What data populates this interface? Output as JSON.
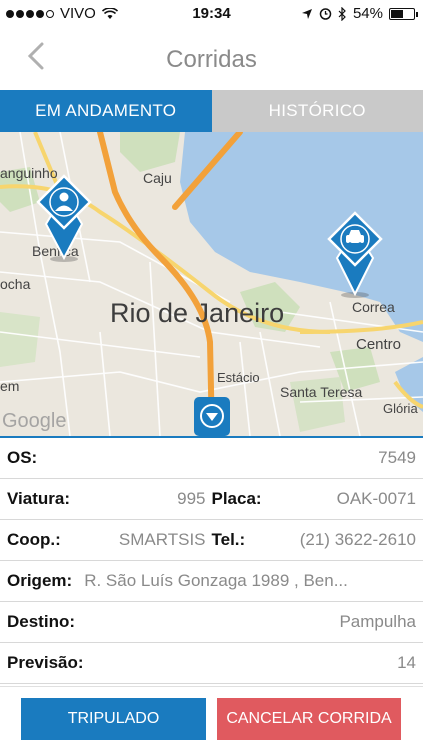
{
  "status_bar": {
    "carrier": "VIVO",
    "time": "19:34",
    "battery": "54%",
    "battery_level": 0.54
  },
  "nav": {
    "title": "Corridas"
  },
  "tabs": [
    {
      "label": "EM ANDAMENTO",
      "active": true
    },
    {
      "label": "HISTÓRICO",
      "active": false
    }
  ],
  "map": {
    "city": "Rio de Janeiro",
    "places": [
      "anguinho",
      "Caju",
      "Benfica",
      "ocha",
      "Correa",
      "Centro",
      "Estácio",
      "Santa Teresa",
      "Glória",
      "em"
    ],
    "attribution": "Google",
    "markers": [
      "person-marker-icon",
      "taxi-marker-icon",
      "location-marker-icon"
    ]
  },
  "details": {
    "os": {
      "label": "OS:",
      "value": "7549"
    },
    "viatura": {
      "label": "Viatura:",
      "value": "995"
    },
    "placa": {
      "label": "Placa:",
      "value": "OAK-0071"
    },
    "coop": {
      "label": "Coop.:",
      "value": "SMARTSIS"
    },
    "tel": {
      "label": "Tel.:",
      "value": "(21) 3622-2610"
    },
    "origem": {
      "label": "Origem:",
      "value": "R. São Luís Gonzaga 1989 , Ben..."
    },
    "destino": {
      "label": "Destino:",
      "value": "Pampulha"
    },
    "previsao": {
      "label": "Previsão:",
      "value": "14"
    }
  },
  "buttons": {
    "tripulado": "TRIPULADO",
    "cancelar": "CANCELAR CORRIDA"
  },
  "colors": {
    "accent": "#1a7bbf",
    "danger": "#e05a5f",
    "tab_inactive": "#c9c9c9",
    "water": "#a6c8e8",
    "road_major": "#f2a13a"
  }
}
